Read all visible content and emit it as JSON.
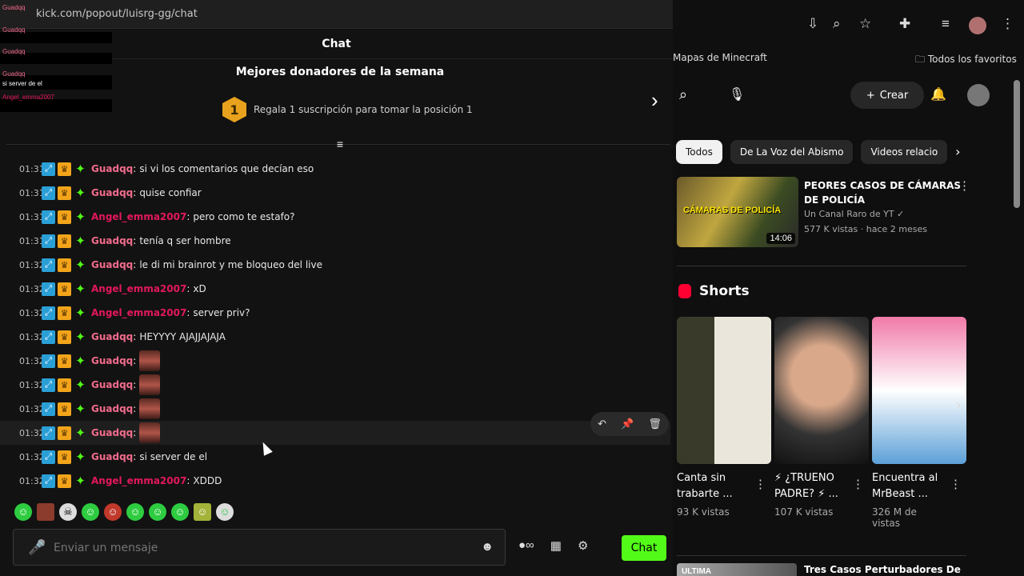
{
  "browser_left": {
    "url": "kick.com/popout/luisrg-gg/chat"
  },
  "overlay": {
    "rows": [
      {
        "user": "Guadqq",
        "text": ""
      },
      {
        "user": "Guadqq",
        "text": ""
      },
      {
        "user": "Guadqq",
        "text": ""
      },
      {
        "user": "Guadqq",
        "text": "si server de el"
      },
      {
        "user": "Angel_emma2007",
        "text": ""
      }
    ]
  },
  "chat": {
    "header": "Chat",
    "donors_title": "Mejores donadores de la semana",
    "donor_rank": "1",
    "donor_text": "Regala 1 suscripción para tomar la posición 1",
    "messages": [
      {
        "time": "01:31",
        "user": "Guadqq",
        "color": "#f36b8c",
        "text": "si vi los comentarios que decían eso",
        "emote": false
      },
      {
        "time": "01:31",
        "user": "Guadqq",
        "color": "#f36b8c",
        "text": "quise confiar",
        "emote": false
      },
      {
        "time": "01:31",
        "user": "Angel_emma2007",
        "color": "#e3185a",
        "text": "pero como te estafo?",
        "emote": false
      },
      {
        "time": "01:31",
        "user": "Guadqq",
        "color": "#f36b8c",
        "text": "tenía q ser hombre",
        "emote": false
      },
      {
        "time": "01:32",
        "user": "Guadqq",
        "color": "#f36b8c",
        "text": "le di mi brainrot y me bloqueo del live",
        "emote": false
      },
      {
        "time": "01:32",
        "user": "Angel_emma2007",
        "color": "#e3185a",
        "text": "xD",
        "emote": false
      },
      {
        "time": "01:32",
        "user": "Angel_emma2007",
        "color": "#e3185a",
        "text": "server priv?",
        "emote": false
      },
      {
        "time": "01:32",
        "user": "Guadqq",
        "color": "#f36b8c",
        "text": "HEYYYY AJAJJAJAJA",
        "emote": false
      },
      {
        "time": "01:32",
        "user": "Guadqq",
        "color": "#f36b8c",
        "text": "",
        "emote": true
      },
      {
        "time": "01:32",
        "user": "Guadqq",
        "color": "#f36b8c",
        "text": "",
        "emote": true
      },
      {
        "time": "01:32",
        "user": "Guadqq",
        "color": "#f36b8c",
        "text": "",
        "emote": true
      },
      {
        "time": "01:32",
        "user": "Guadqq",
        "color": "#f36b8c",
        "text": "",
        "emote": true
      },
      {
        "time": "01:32",
        "user": "Guadqq",
        "color": "#f36b8c",
        "text": "si server de el",
        "emote": false
      },
      {
        "time": "01:32",
        "user": "Angel_emma2007",
        "color": "#e3185a",
        "text": "XDDD",
        "emote": false
      }
    ],
    "input_placeholder": "Enviar un mensaje",
    "send_label": "Chat"
  },
  "browser_right": {
    "bookmarks": [
      "Mapas de Minecraft",
      "Todos los favoritos"
    ]
  },
  "youtube": {
    "create_label": "Crear",
    "chips": [
      "Todos",
      "De La Voz del Abismo",
      "Videos relacio"
    ],
    "video": {
      "title": "PEORES CASOS DE CÁMARAS DE POLICÍA",
      "thumb_text": "CÁMARAS DE POLICÍA",
      "channel": "Un Canal Raro de YT",
      "meta": "577 K vistas · hace 2 meses",
      "duration": "14:06"
    },
    "shorts_label": "Shorts",
    "shorts": [
      {
        "title": "Canta sin trabarte ...",
        "views": "93 K vistas"
      },
      {
        "title": "⚡ ¿TRUENO PADRE? ⚡ ...",
        "views": "107 K vistas"
      },
      {
        "title": "Encuentra al MrBeast ...",
        "views": "326 M de vistas"
      }
    ],
    "bottom_video_title": "Tres Casos Perturbadores De",
    "bottom_thumb_text": "ULTIMA"
  }
}
